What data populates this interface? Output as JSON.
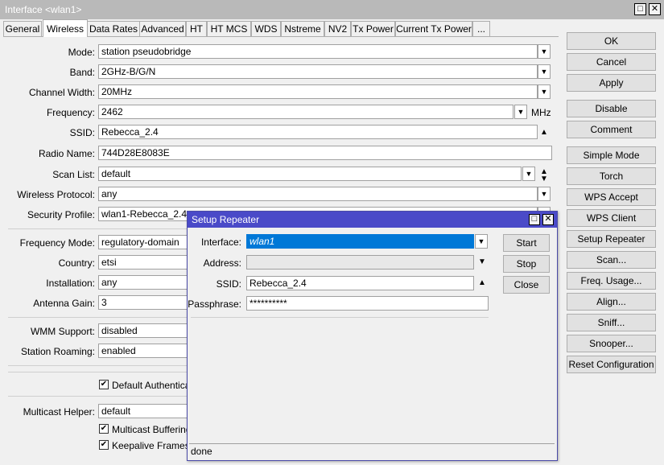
{
  "window": {
    "title": "Interface <wlan1>",
    "restore_glyph": "□",
    "close_glyph": "✕"
  },
  "tabs": [
    "General",
    "Wireless",
    "Data Rates",
    "Advanced",
    "HT",
    "HT MCS",
    "WDS",
    "Nstreme",
    "NV2",
    "Tx Power",
    "Current Tx Power",
    "..."
  ],
  "form": {
    "mode": {
      "label": "Mode:",
      "value": "station pseudobridge"
    },
    "band": {
      "label": "Band:",
      "value": "2GHz-B/G/N"
    },
    "channel_width": {
      "label": "Channel Width:",
      "value": "20MHz"
    },
    "frequency": {
      "label": "Frequency:",
      "value": "2462",
      "unit": "MHz"
    },
    "ssid": {
      "label": "SSID:",
      "value": "Rebecca_2.4"
    },
    "radio_name": {
      "label": "Radio Name:",
      "value": "744D28E8083E"
    },
    "scan_list": {
      "label": "Scan List:",
      "value": "default"
    },
    "wireless_protocol": {
      "label": "Wireless Protocol:",
      "value": "any"
    },
    "security_profile": {
      "label": "Security Profile:",
      "value": "wlan1-Rebecca_2.4-re"
    },
    "frequency_mode": {
      "label": "Frequency Mode:",
      "value": "regulatory-domain"
    },
    "country": {
      "label": "Country:",
      "value": "etsi"
    },
    "installation": {
      "label": "Installation:",
      "value": "any"
    },
    "antenna_gain": {
      "label": "Antenna Gain:",
      "value": "3"
    },
    "wmm_support": {
      "label": "WMM Support:",
      "value": "disabled"
    },
    "station_roaming": {
      "label": "Station Roaming:",
      "value": "enabled"
    },
    "default_authenticate": {
      "label": "Default Authenticate",
      "checked": true
    },
    "multicast_helper": {
      "label": "Multicast Helper:",
      "value": "default"
    },
    "multicast_buffering": {
      "label": "Multicast Buffering",
      "checked": true
    },
    "keepalive_frames": {
      "label": "Keepalive Frames",
      "checked": true
    }
  },
  "side_buttons": [
    "OK",
    "Cancel",
    "Apply",
    "Disable",
    "Comment",
    "Simple Mode",
    "Torch",
    "WPS Accept",
    "WPS Client",
    "Setup Repeater",
    "Scan...",
    "Freq. Usage...",
    "Align...",
    "Sniff...",
    "Snooper...",
    "Reset Configuration"
  ],
  "dialog": {
    "title": "Setup Repeater",
    "interface": {
      "label": "Interface:",
      "value": "wlan1"
    },
    "address": {
      "label": "Address:",
      "value": ""
    },
    "ssid": {
      "label": "SSID:",
      "value": "Rebecca_2.4"
    },
    "passphrase": {
      "label": "Passphrase:",
      "value": "**********"
    },
    "buttons": [
      "Start",
      "Stop",
      "Close"
    ],
    "status": "done"
  },
  "glyphs": {
    "dropdown": "▼",
    "up": "▲",
    "check": "✔"
  },
  "colors": {
    "dialog_title_bg": "#4a4ac8",
    "window_title_bg": "#b9b9b9",
    "selection": "#0078d7"
  }
}
